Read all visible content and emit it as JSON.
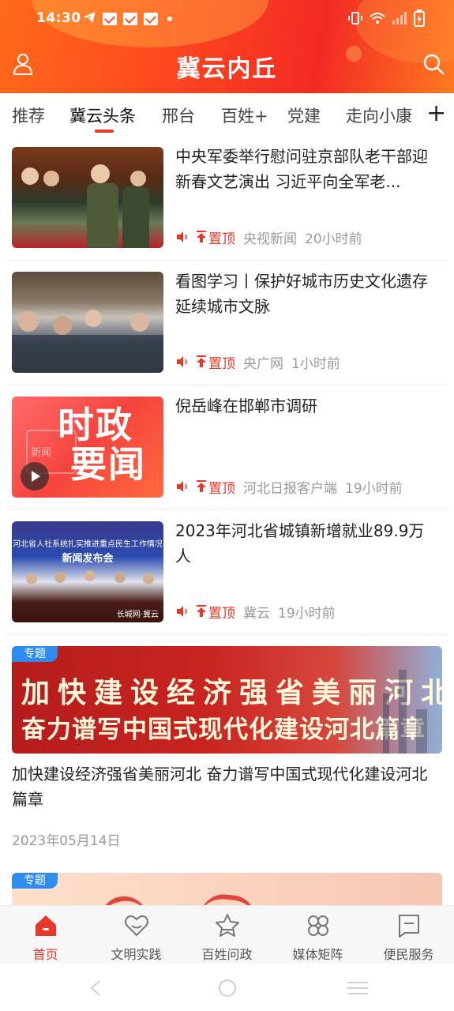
{
  "status_bar": {
    "time": "14:30"
  },
  "header": {
    "title": "冀云内丘"
  },
  "tabs": [
    {
      "label": "推荐"
    },
    {
      "label": "冀云头条"
    },
    {
      "label": "邢台"
    },
    {
      "label": "百姓+"
    },
    {
      "label": "党建"
    },
    {
      "label": "走向小康"
    }
  ],
  "news": [
    {
      "title": "中央军委举行慰问驻京部队老干部迎新春文艺演出 习近平向全军老...",
      "pin": "置顶",
      "source": "央视新闻",
      "time": "20小时前"
    },
    {
      "title": "看图学习丨保护好城市历史文化遗存 延续城市文脉",
      "pin": "置顶",
      "source": "央广网",
      "time": "1小时前"
    },
    {
      "title": "倪岳峰在邯郸市调研",
      "pin": "置顶",
      "source": "河北日报客户端",
      "time": "19小时前",
      "thumb_text": [
        "时政",
        "要闻"
      ],
      "thumb_small": "新闻"
    },
    {
      "title": "2023年河北省城镇新增就业89.9万人",
      "pin": "置顶",
      "source": "冀云",
      "time": "19小时前",
      "thumb_text": [
        "河北省人社系统扎实推进重点民生工作情况",
        "新闻发布会",
        "长城网·冀云"
      ]
    }
  ],
  "special": {
    "tag": "专题",
    "banner_line1": "加快建设经济强省美丽河北",
    "banner_line2": "奋力谱写中国式现代化建设河北篇章",
    "title": "加快建设经济强省美丽河北 奋力谱写中国式现代化建设河北篇章",
    "date": "2023年05月14日"
  },
  "special2": {
    "tag": "专题"
  },
  "bottom_nav": [
    {
      "label": "首页",
      "icon": "home-icon",
      "active": true
    },
    {
      "label": "文明实践",
      "icon": "heart-icon",
      "active": false
    },
    {
      "label": "百姓问政",
      "icon": "star-icon",
      "active": false
    },
    {
      "label": "媒体矩阵",
      "icon": "grid-icon",
      "active": false
    },
    {
      "label": "便民服务",
      "icon": "bookmark-icon",
      "active": false
    }
  ],
  "colors": {
    "accent": "#e8382a",
    "header_start": "#ff6a1a",
    "header_end": "#f22a24",
    "tag_blue": "#2e8cf0"
  }
}
